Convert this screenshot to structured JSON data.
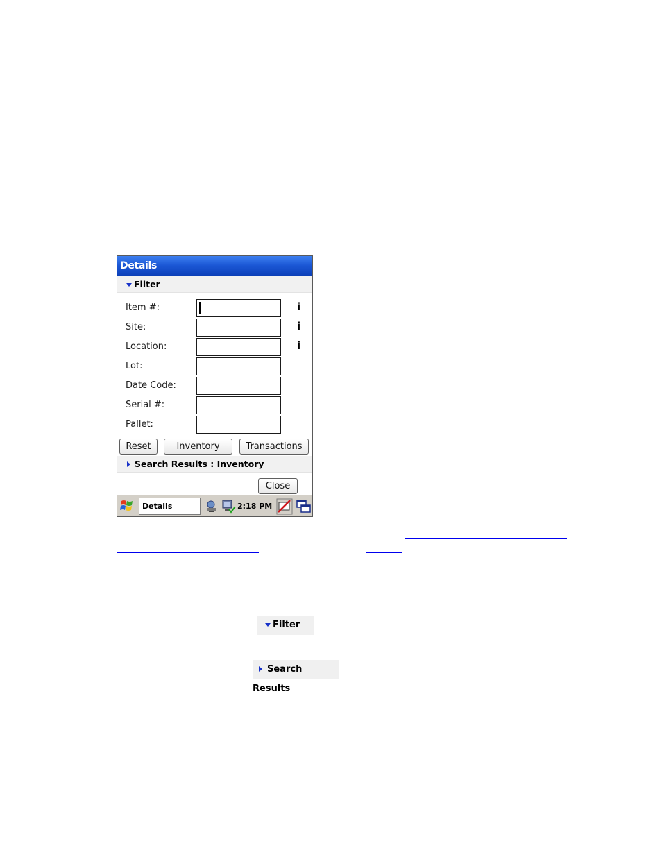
{
  "window": {
    "title": "Details"
  },
  "filter": {
    "header": "Filter",
    "fields": [
      {
        "label": "Item #:",
        "value": "",
        "info": "i"
      },
      {
        "label": "Site:",
        "value": "",
        "info": "i"
      },
      {
        "label": "Location:",
        "value": "",
        "info": "i"
      },
      {
        "label": "Lot:",
        "value": ""
      },
      {
        "label": "Date Code:",
        "value": ""
      },
      {
        "label": "Serial #:",
        "value": ""
      },
      {
        "label": "Pallet:",
        "value": ""
      }
    ]
  },
  "buttons": {
    "reset": "Reset",
    "inventory": "Inventory",
    "transactions": "Transactions",
    "close": "Close"
  },
  "results": {
    "header": "Search Results : Inventory"
  },
  "taskbar": {
    "active_app": "Details",
    "time": "2:18 PM"
  },
  "snippets": {
    "filter": "Filter",
    "search_results": "Search Results"
  },
  "colors": {
    "titlebar": "#1c58d6",
    "triangle": "#1832c9",
    "link": "#0000ee"
  }
}
